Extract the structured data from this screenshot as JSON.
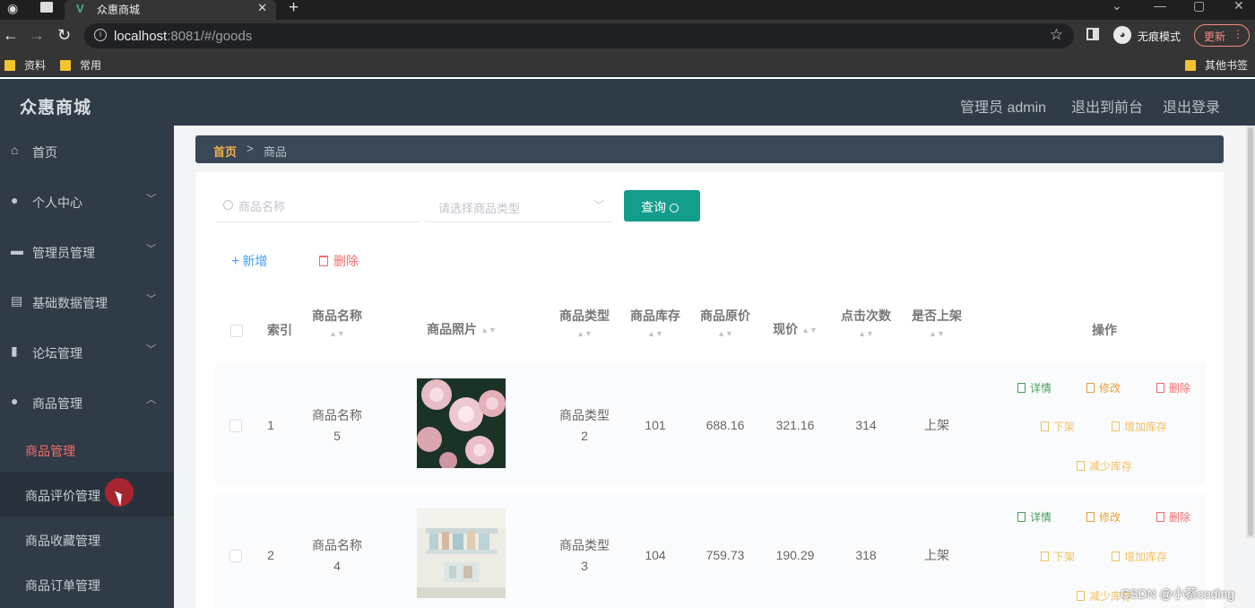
{
  "browser": {
    "tab_title": "众惠商城",
    "url_host": "localhost",
    "url_rest": ":8081/#/goods",
    "incognito_label": "无痕模式",
    "update_label": "更新",
    "bookmarks": [
      "资料",
      "常用"
    ],
    "other_bookmarks": "其他书签"
  },
  "header": {
    "brand": "众惠商城",
    "admin_label": "管理员 admin",
    "to_front": "退出到前台",
    "logout": "退出登录"
  },
  "sidebar": {
    "items": [
      {
        "label": "首页",
        "icon": "home-icon"
      },
      {
        "label": "个人中心",
        "icon": "user-icon"
      },
      {
        "label": "管理员管理",
        "icon": "chat-icon"
      },
      {
        "label": "基础数据管理",
        "icon": "clipboard-icon"
      },
      {
        "label": "论坛管理",
        "icon": "bar-chart-icon"
      },
      {
        "label": "商品管理",
        "icon": "user-icon"
      }
    ],
    "subitems": [
      {
        "label": "商品管理"
      },
      {
        "label": "商品评价管理"
      },
      {
        "label": "商品收藏管理"
      },
      {
        "label": "商品订单管理"
      }
    ]
  },
  "breadcrumb": {
    "home": "首页",
    "current": "商品"
  },
  "search": {
    "name_placeholder": "商品名称",
    "type_placeholder": "请选择商品类型",
    "query_label": "查询"
  },
  "actions": {
    "add": "新增",
    "delete": "删除"
  },
  "table": {
    "headers": {
      "index": "索引",
      "name": "商品名称",
      "photo": "商品照片",
      "type": "商品类型",
      "stock": "商品库存",
      "old_price": "商品原价",
      "price": "现价",
      "clicks": "点击次数",
      "on_shelf": "是否上架",
      "ops": "操作"
    },
    "rows": [
      {
        "index": "1",
        "name_line1": "商品名称",
        "name_line2": "5",
        "type_line1": "商品类型",
        "type_line2": "2",
        "stock": "101",
        "old_price": "688.16",
        "price": "321.16",
        "clicks": "314",
        "on_shelf": "上架"
      },
      {
        "index": "2",
        "name_line1": "商品名称",
        "name_line2": "4",
        "type_line1": "商品类型",
        "type_line2": "3",
        "stock": "104",
        "old_price": "759.73",
        "price": "190.29",
        "clicks": "318",
        "on_shelf": "上架"
      }
    ],
    "op_labels": {
      "detail": "详情",
      "edit": "修改",
      "delete": "删除",
      "off_shelf": "下架",
      "add_stock": "增加库存",
      "reduce_stock": "减少库存"
    }
  },
  "watermark": "CSDN @小蔡coding",
  "colors": {
    "sidebar": "#2f3b46",
    "accent": "#139d8a",
    "active": "#f56c6c",
    "breadcrumb_home": "#f0b34a"
  }
}
